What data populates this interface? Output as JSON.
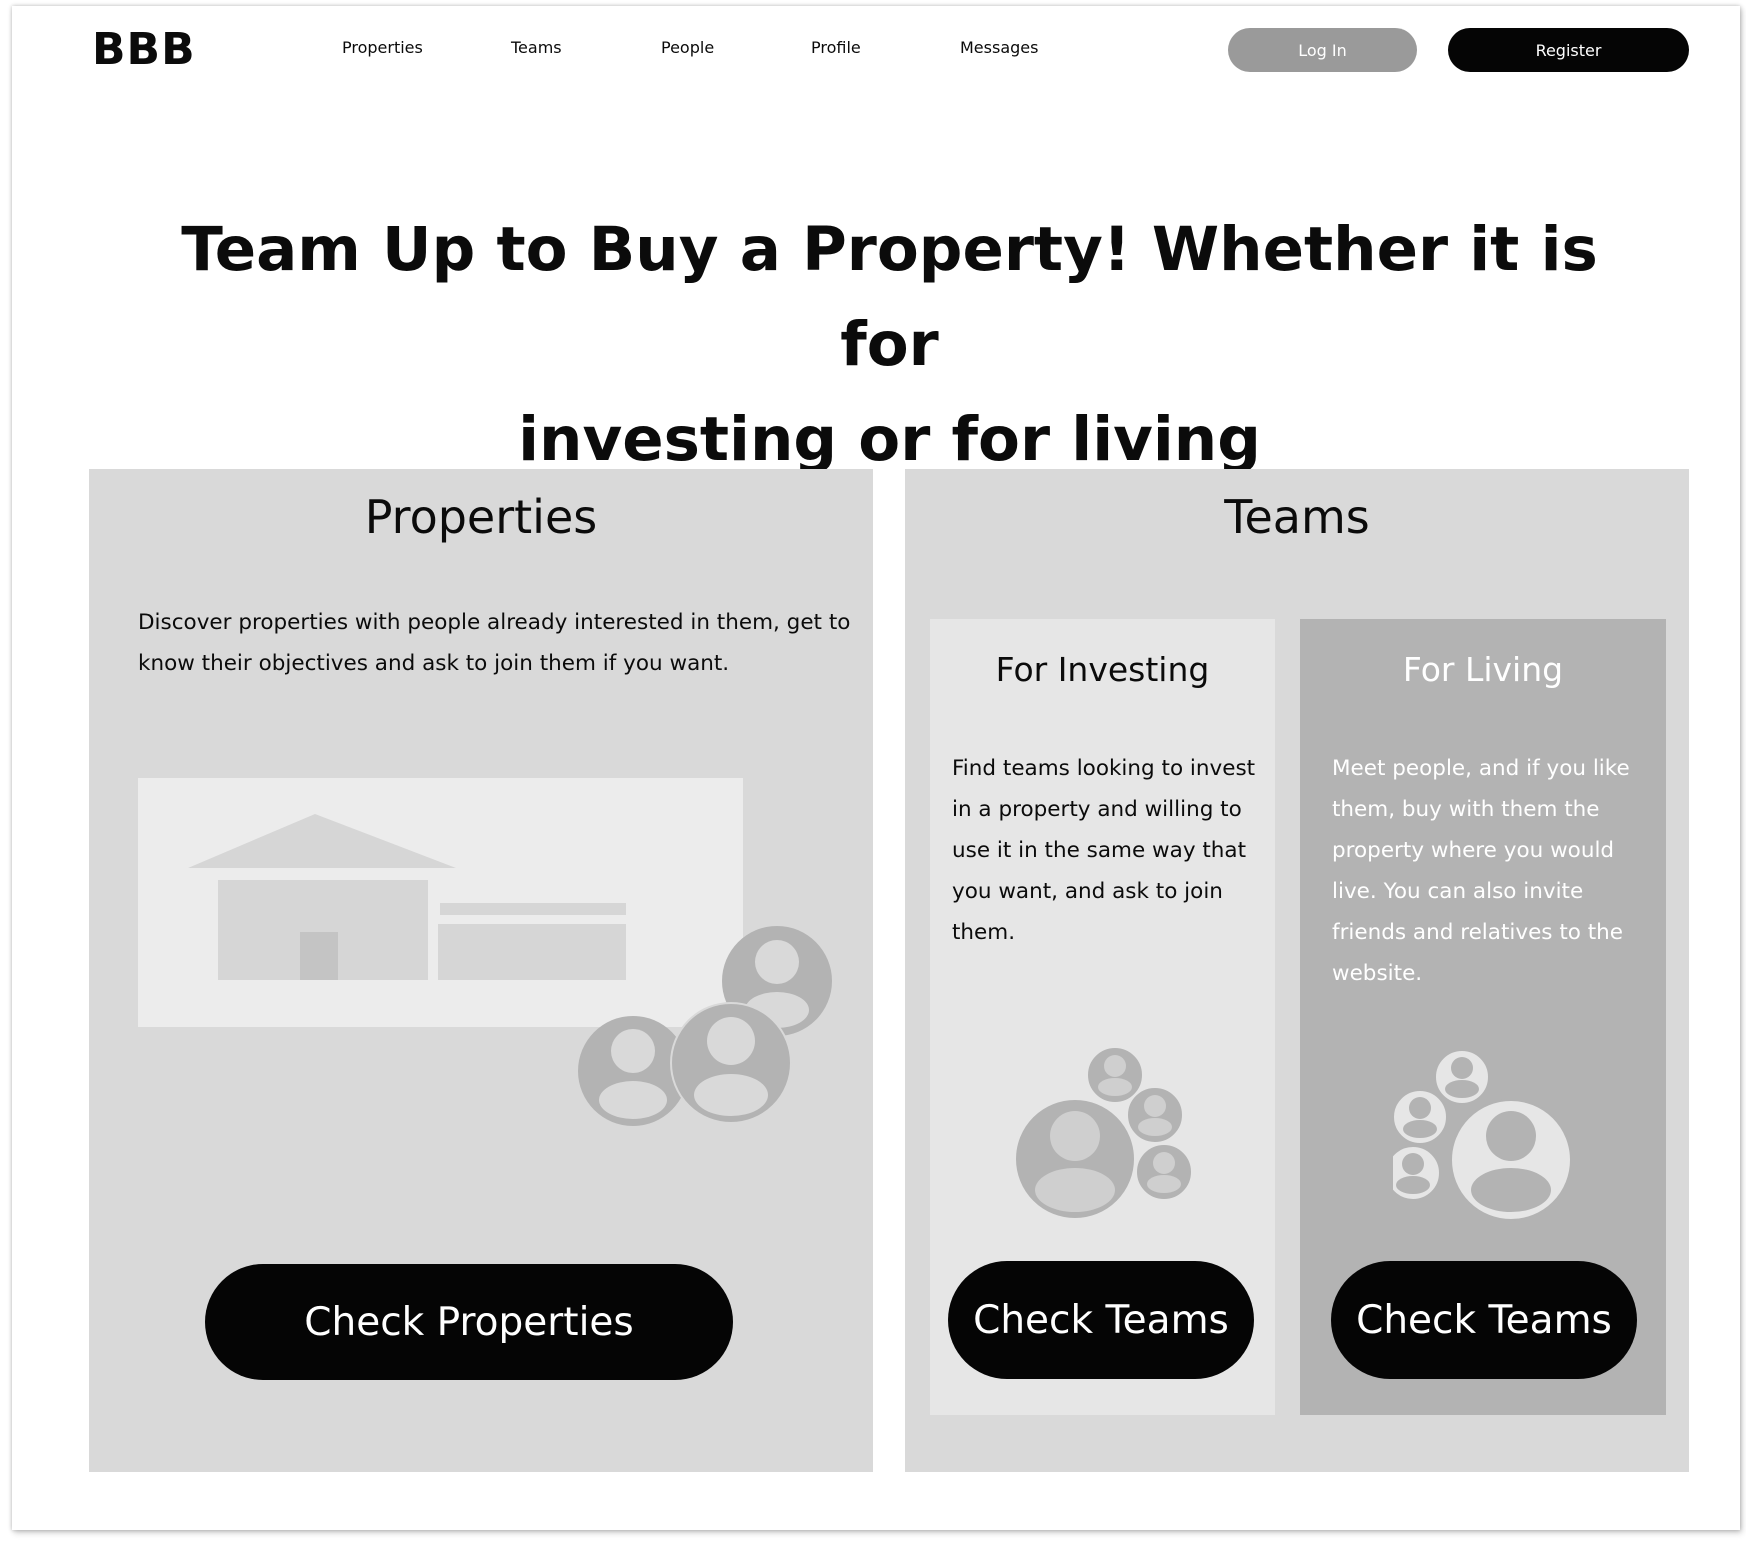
{
  "header": {
    "logo": "BBB",
    "nav": [
      "Properties",
      "Teams",
      "People",
      "Profile",
      "Messages"
    ],
    "login_label": "Log In",
    "register_label": "Register"
  },
  "hero": {
    "line1": "Team Up to Buy a Property! Whether it is for",
    "line2": "investing or for living"
  },
  "properties_card": {
    "title": "Properties",
    "description": "Discover properties with people already interested in them, get to know their objectives and ask to join them if you want.",
    "button_label": "Check Properties"
  },
  "teams_card": {
    "title": "Teams",
    "investing": {
      "title": "For Investing",
      "description": "Find teams looking to invest in a property and willing to use it in the same way that you want, and ask to join them.",
      "button_label": "Check Teams"
    },
    "living": {
      "title": "For Living",
      "description": "Meet people, and if you like them, buy with them the property where you would  live. You can also invite friends and relatives to the website.",
      "button_label": "Check Teams"
    }
  },
  "colors": {
    "card_bg": "#d9d9d9",
    "invest_bg": "#e6e6e6",
    "living_bg": "#b3b3b3",
    "button_dark": "#050505",
    "login_bg": "#9a9a9a"
  }
}
